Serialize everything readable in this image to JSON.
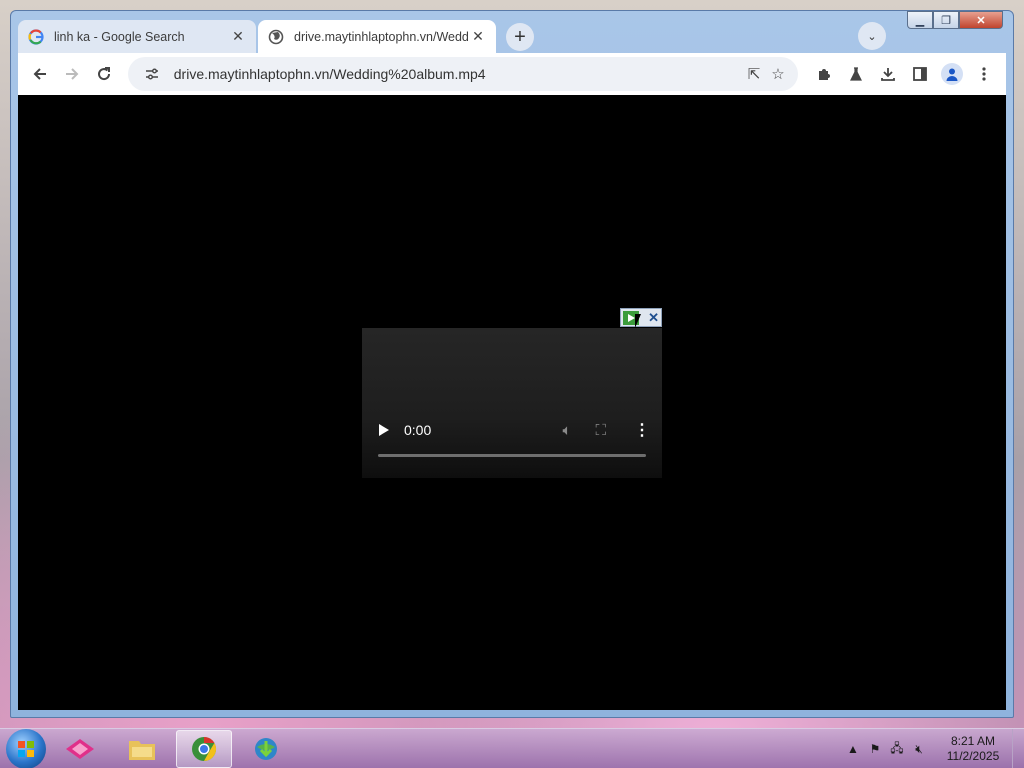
{
  "browser": {
    "tabs": [
      {
        "title": "linh ka - Google Search",
        "favicon": "google-icon",
        "active": false
      },
      {
        "title": "drive.maytinhlaptophn.vn/Wedd",
        "favicon": "globe-icon",
        "active": true
      }
    ],
    "address": "drive.maytinhlaptophn.vn/Wedding%20album.mp4"
  },
  "video_player": {
    "time": "0:00",
    "progress": 0
  },
  "taskbar": {
    "clock_time": "8:21 AM",
    "clock_date": "11/2/2025"
  },
  "colors": {
    "content_bg": "#000000",
    "active_tab": "#ffffff",
    "inactive_tab": "#dfe7f3"
  }
}
